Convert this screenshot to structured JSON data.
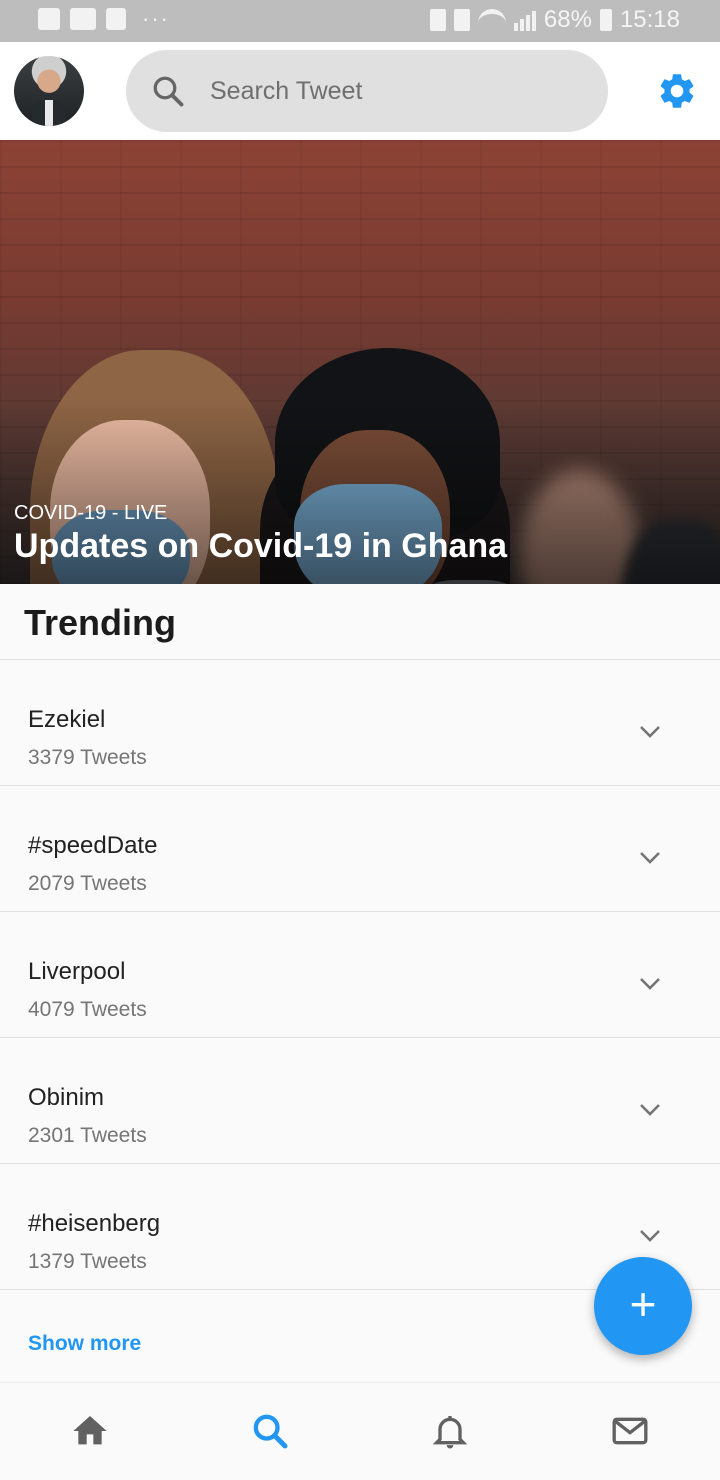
{
  "status_bar": {
    "battery": "68%",
    "time": "15:18",
    "more": "···"
  },
  "header": {
    "search_placeholder": "Search Tweet",
    "icons": [
      "search-icon",
      "gear-icon"
    ]
  },
  "hero": {
    "kicker": "COVID-19 - LIVE",
    "headline": "Updates on Covid-19 in Ghana"
  },
  "trending": {
    "title": "Trending",
    "items": [
      {
        "name": "Ezekiel",
        "count": "3379 Tweets"
      },
      {
        "name": "#speedDate",
        "count": "2079 Tweets"
      },
      {
        "name": "Liverpool",
        "count": "4079 Tweets"
      },
      {
        "name": "Obinim",
        "count": "2301 Tweets"
      },
      {
        "name": "#heisenberg",
        "count": "1379 Tweets"
      }
    ],
    "show_more": "Show more"
  },
  "fab": {
    "label": "+"
  },
  "bottom_nav": {
    "items": [
      "home-icon",
      "search-icon",
      "bell-icon",
      "mail-icon"
    ],
    "active": "search-icon"
  },
  "colors": {
    "accent": "#2196f3",
    "search_bg": "#e0e0e0",
    "status_bar": "#bdbdbd",
    "nav_icon": "#616161"
  }
}
